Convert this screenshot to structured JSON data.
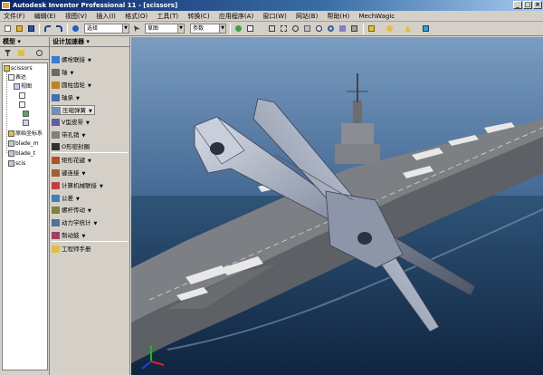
{
  "window": {
    "title": "Autodesk Inventor Professional 11 - [scissors]",
    "min_label": "_",
    "max_label": "□",
    "close_label": "×"
  },
  "menu": [
    {
      "label": "文件(F)"
    },
    {
      "label": "编辑(E)"
    },
    {
      "label": "视图(V)"
    },
    {
      "label": "插入(I)"
    },
    {
      "label": "格式(O)"
    },
    {
      "label": "工具(T)"
    },
    {
      "label": "转换(C)"
    },
    {
      "label": "应用程序(A)"
    },
    {
      "label": "窗口(W)"
    },
    {
      "label": "网站(B)"
    },
    {
      "label": "帮助(H)"
    },
    {
      "label": "MechWagic"
    }
  ],
  "toolbar": {
    "select_combo": "选择",
    "sketch_combo": "草图",
    "style_combo": "参数"
  },
  "browser": {
    "title": "模型 ▾",
    "tree": [
      {
        "label": "scissors"
      },
      {
        "label": "表达"
      },
      {
        "label": "视图"
      },
      {
        "label": "原始坐标系"
      },
      {
        "label": "blade_m"
      },
      {
        "label": "blade_t"
      },
      {
        "label": "scis"
      }
    ]
  },
  "panel": {
    "title": "设计加速器 ▾",
    "tools": [
      {
        "label": "螺栓联接",
        "color": "#3a7ad0"
      },
      {
        "label": "轴",
        "color": "#6a6a6a"
      },
      {
        "label": "圆柱齿轮",
        "color": "#c08020"
      },
      {
        "label": "轴承",
        "color": "#4070b0"
      },
      {
        "label": "压缩弹簧",
        "color": "#7090c0"
      },
      {
        "label": "V型皮带",
        "color": "#6060a0"
      },
      {
        "label": "带孔销",
        "color": "#808080"
      },
      {
        "label": "O形密封圈",
        "color": "#303030"
      },
      {
        "label": "矩形花键",
        "color": "#b05020"
      },
      {
        "label": "键连接",
        "color": "#a06030"
      },
      {
        "label": "计算机械联接",
        "color": "#c04040"
      },
      {
        "label": "公差",
        "color": "#4080c0"
      },
      {
        "label": "螺杆传动",
        "color": "#808040"
      },
      {
        "label": "动力学统计",
        "color": "#5070a0"
      },
      {
        "label": "制动鼓",
        "color": "#a04060"
      },
      {
        "label": "工程师手册",
        "color": "#e0c040"
      }
    ]
  },
  "viewport": {
    "sky_color": "#5a7fa8",
    "sea_color": "#1e3a5a",
    "metal_color": "#9aa4b8"
  }
}
